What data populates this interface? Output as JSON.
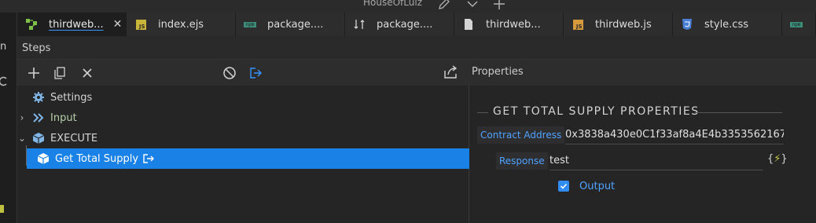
{
  "window": {
    "title": "HouseOfLuiz"
  },
  "tabs": [
    {
      "label": "thirdweb...",
      "icon": "flow-icon",
      "active": true,
      "close": "✕"
    },
    {
      "label": "index.ejs",
      "icon": "js-file-icon"
    },
    {
      "label": "package....",
      "icon": "npm-icon"
    },
    {
      "label": "package....",
      "icon": "diff-icon"
    },
    {
      "label": "thirdweb...",
      "icon": "file-icon"
    },
    {
      "label": "thirdweb.js",
      "icon": "js-file-icon"
    },
    {
      "label": "style.css",
      "icon": "css-icon"
    }
  ],
  "tab_badges": {
    "js": "JS",
    "npm": "npm"
  },
  "gutter": {
    "letter": "n"
  },
  "steps": {
    "title": "Steps"
  },
  "properties": {
    "title": "Properties",
    "section_title": "GET TOTAL SUPPLY PROPERTIES",
    "contract_address_label": "Contract Address",
    "contract_address_value": "0x3838a430e0C1f33af8a4E4b3353562167",
    "response_label": "Response",
    "response_value": "test",
    "braces_open": "{",
    "braces_close": "}",
    "output_label": "Output",
    "output_checked": true
  },
  "tree": [
    {
      "label": "Settings",
      "icon": "gear-icon",
      "color": "#d4d4d4"
    },
    {
      "label": "Input",
      "icon": "double-chevron-icon",
      "color": "#b5cea8",
      "chevron": "›"
    },
    {
      "label": "EXECUTE",
      "icon": "cube-icon",
      "color": "#d4d4d4",
      "chevron": "⌄"
    },
    {
      "label": "Get Total Supply",
      "icon": "cube-icon",
      "color": "#ffffff",
      "selected": true
    }
  ],
  "colors": {
    "accent": "#1a82e6",
    "link": "#4fa3ff",
    "js": "#c9b53a",
    "npm": "#3c8c7a",
    "css": "#4a7fd6"
  }
}
